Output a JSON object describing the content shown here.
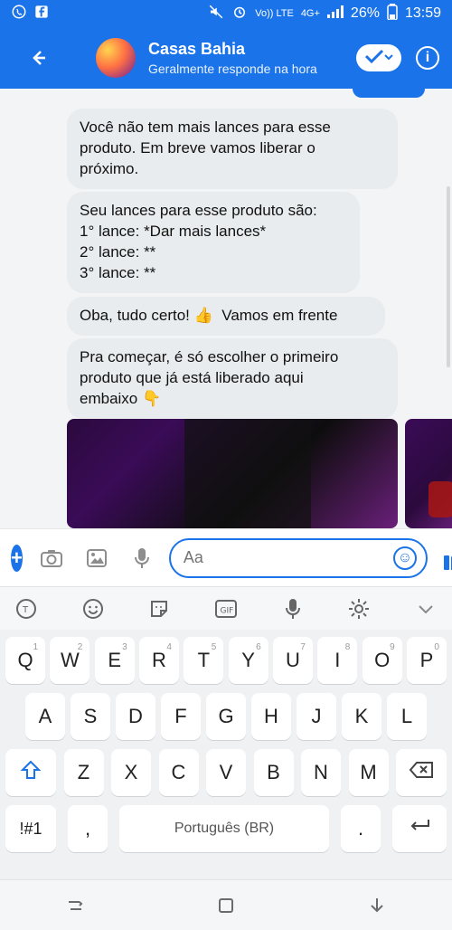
{
  "status_bar": {
    "left_icons": [
      "whatsapp-icon",
      "facebook-icon"
    ],
    "right_icons": [
      "mute-icon",
      "alarm-icon",
      "volte-icon",
      "network-4g-icon",
      "signal-icon"
    ],
    "volte_text": "Vo)) LTE",
    "net_text": "4G+",
    "battery_text": "26%",
    "time": "13:59"
  },
  "header": {
    "title": "Casas Bahia",
    "subtitle": "Geralmente responde na hora",
    "icons": [
      "back-arrow-icon",
      "check-icon",
      "chevron-down-icon",
      "info-icon"
    ]
  },
  "messages": [
    {
      "text": "Você não tem mais lances para esse\nproduto. Em breve vamos liberar o\npróximo."
    },
    {
      "text": "Seu lances para esse produto são:\n1° lance: *Dar mais lances*\n2° lance: **\n3° lance: **"
    },
    {
      "text": "Oba, tudo certo! 👍  Vamos em frente"
    },
    {
      "text": "Pra começar, é só escolher o primeiro\nproduto que já está liberado aqui\nembaixo 👇"
    }
  ],
  "composer": {
    "placeholder": "Aa",
    "icons": [
      "plus-icon",
      "camera-icon",
      "image-icon",
      "mic-icon",
      "emoji-icon",
      "thumbs-up-icon"
    ]
  },
  "keyboard_toolbar": {
    "icons": [
      "translate-icon",
      "emoji-icon",
      "sticker-icon",
      "gif-icon",
      "mic-icon",
      "settings-icon",
      "chevron-down-icon"
    ]
  },
  "keyboard": {
    "row1": [
      {
        "label": "Q",
        "num": "1"
      },
      {
        "label": "W",
        "num": "2"
      },
      {
        "label": "E",
        "num": "3"
      },
      {
        "label": "R",
        "num": "4"
      },
      {
        "label": "T",
        "num": "5"
      },
      {
        "label": "Y",
        "num": "6"
      },
      {
        "label": "U",
        "num": "7"
      },
      {
        "label": "I",
        "num": "8"
      },
      {
        "label": "O",
        "num": "9"
      },
      {
        "label": "P",
        "num": "0"
      }
    ],
    "row2": [
      "A",
      "S",
      "D",
      "F",
      "G",
      "H",
      "J",
      "K",
      "L"
    ],
    "row3": [
      "Z",
      "X",
      "C",
      "V",
      "B",
      "N",
      "M"
    ],
    "row4": {
      "sym": "!#1",
      "comma": ",",
      "space": "Português (BR)",
      "period": "."
    }
  },
  "nav_bar": {
    "icons": [
      "recent-apps-icon",
      "home-icon",
      "back-icon"
    ]
  },
  "colors": {
    "accent": "#1a73e8",
    "chat_bg": "#f2f4f6",
    "bubble": "#e9ecef"
  }
}
